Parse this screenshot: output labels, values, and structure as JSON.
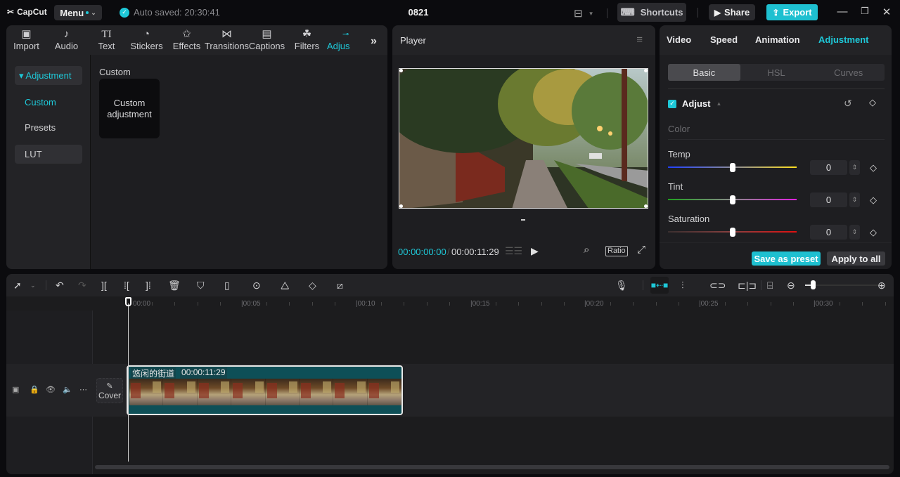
{
  "app": {
    "logo": "CapCut",
    "menu_label": "Menu",
    "autosave": "Auto saved: 20:30:41",
    "project_title": "0821",
    "shortcuts_label": "Shortcuts",
    "share_label": "Share",
    "export_label": "Export",
    "accent_color": "#1ec8d8"
  },
  "media_tabs": [
    {
      "label": "Import",
      "icon": "import-icon"
    },
    {
      "label": "Audio",
      "icon": "audio-icon"
    },
    {
      "label": "Text",
      "icon": "text-icon"
    },
    {
      "label": "Stickers",
      "icon": "stickers-icon"
    },
    {
      "label": "Effects",
      "icon": "effects-icon"
    },
    {
      "label": "Transitions",
      "icon": "transitions-icon"
    },
    {
      "label": "Captions",
      "icon": "captions-icon"
    },
    {
      "label": "Filters",
      "icon": "filters-icon"
    },
    {
      "label": "Adjus",
      "icon": "adjustment-icon",
      "active": true
    }
  ],
  "sidebar": {
    "items": [
      {
        "label": "▾ Adjustment"
      },
      {
        "label": "Custom"
      },
      {
        "label": "Presets"
      },
      {
        "label": "LUT"
      }
    ]
  },
  "custom_section": {
    "heading": "Custom",
    "card_label": "Custom adjustment"
  },
  "player": {
    "title": "Player",
    "current_time": "00:00:00:00",
    "separator": "/",
    "duration": "00:00:11:29",
    "ratio_label": "Ratio"
  },
  "inspector": {
    "tabs": [
      "Video",
      "Speed",
      "Animation",
      "Adjustment"
    ],
    "active_tab": "Adjustment",
    "segments": [
      "Basic",
      "HSL",
      "Curves"
    ],
    "active_segment": "Basic",
    "adjust_title": "Adjust",
    "adjust_enabled": true,
    "color_heading": "Color",
    "sliders": [
      {
        "label": "Temp",
        "value": "0",
        "min": -50,
        "max": 50
      },
      {
        "label": "Tint",
        "value": "0",
        "min": -50,
        "max": 50
      },
      {
        "label": "Saturation",
        "value": "0",
        "min": -50,
        "max": 50
      }
    ],
    "save_preset_label": "Save as preset",
    "apply_all_label": "Apply to all"
  },
  "timeline": {
    "ruler_labels": [
      "00:00",
      "|00:05",
      "|00:10",
      "|00:15",
      "|00:20",
      "|00:25",
      "|00:30"
    ],
    "cover_label": "Cover",
    "clip": {
      "name": "悠闲的街道",
      "duration": "00:00:11:29"
    },
    "zoom_level": 0.1
  }
}
